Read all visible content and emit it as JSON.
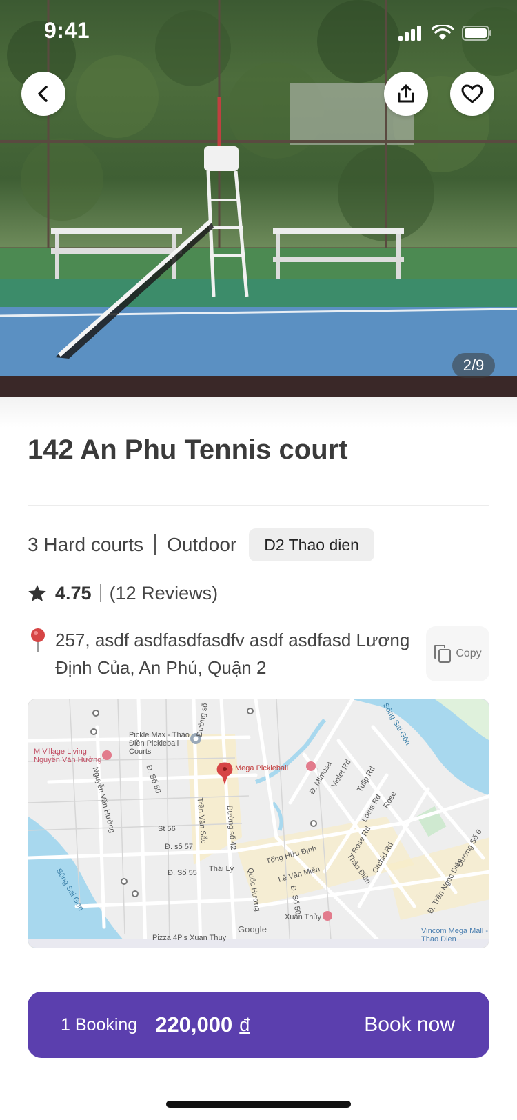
{
  "status_bar": {
    "time": "9:41",
    "icons": [
      "signal-icon",
      "wifi-icon",
      "battery-icon"
    ]
  },
  "hero": {
    "photo_counter": "2/9",
    "buttons": [
      "back-arrow-icon",
      "share-icon",
      "heart-icon"
    ]
  },
  "court": {
    "title": "142 An Phu Tennis court",
    "court_count": "3 Hard courts",
    "setting": "Outdoor",
    "district": "D2 Thao dien",
    "rating": "4.75",
    "reviews": "(12 Reviews)",
    "address": "257, asdf asdfasdfasdfv asdf asdfasd Lương Định Của, An Phú, Quận 2",
    "copy_label": "Copy"
  },
  "map": {
    "labels": {
      "pickle_max": "Pickle Max - Thảo Điền Pickleball Courts",
      "mega_pickleball": "Mega Pickleball",
      "m_village": "M Village Living Nguyễn Văn Hưởng",
      "song_sai_gon_left": "Sông Sài Gòn",
      "song_sai_gon_right": "Sông Sài Gòn",
      "nguyen_van_huong": "Nguyễn Văn Hưởng",
      "tran_van_sac": "Trần Văn Sắc",
      "duong_so_42": "Đường số 42",
      "quoc_huong": "Quốc Hương",
      "thai_ly": "Thái Lý",
      "tong_huu_dinh": "Tống Hữu Định",
      "le_van_mien": "Lê Văn Miến",
      "xuan_thuy": "Xuân Thủy",
      "pizza_4ps": "Pizza 4P's Xuan Thuy",
      "thao_dien": "Thảo Điền",
      "vincom": "Vincom Mega Mall - Thao Dien",
      "tran_ngoc_dien": "Đ. Trần Ngọc Diện",
      "st_56": "St 56",
      "d_so_57": "Đ. số 57",
      "d_so_55": "Đ. Số 55",
      "d_so_60": "Đ. Số 60",
      "d_so_50": "Đ. Số 50",
      "violet_rd": "Violet Rd",
      "tulip_rd": "Tulip Rd",
      "lotus_rd": "Lotus Rd",
      "rose": "Rose",
      "rose_rd": "Rose Rd",
      "orchid_rd": "Orchid Rd",
      "mimosa": "Đ. Mimosa",
      "duong_so_6": "Đường Số 6",
      "duong_so": "Đường số",
      "google": "Google"
    }
  },
  "booking": {
    "count": "1 Booking",
    "price": "220,000",
    "currency": "đ",
    "cta": "Book now"
  },
  "colors": {
    "primary": "#5b3fae",
    "water": "#a8d8ee",
    "road_highlight": "#f8ecc8"
  }
}
